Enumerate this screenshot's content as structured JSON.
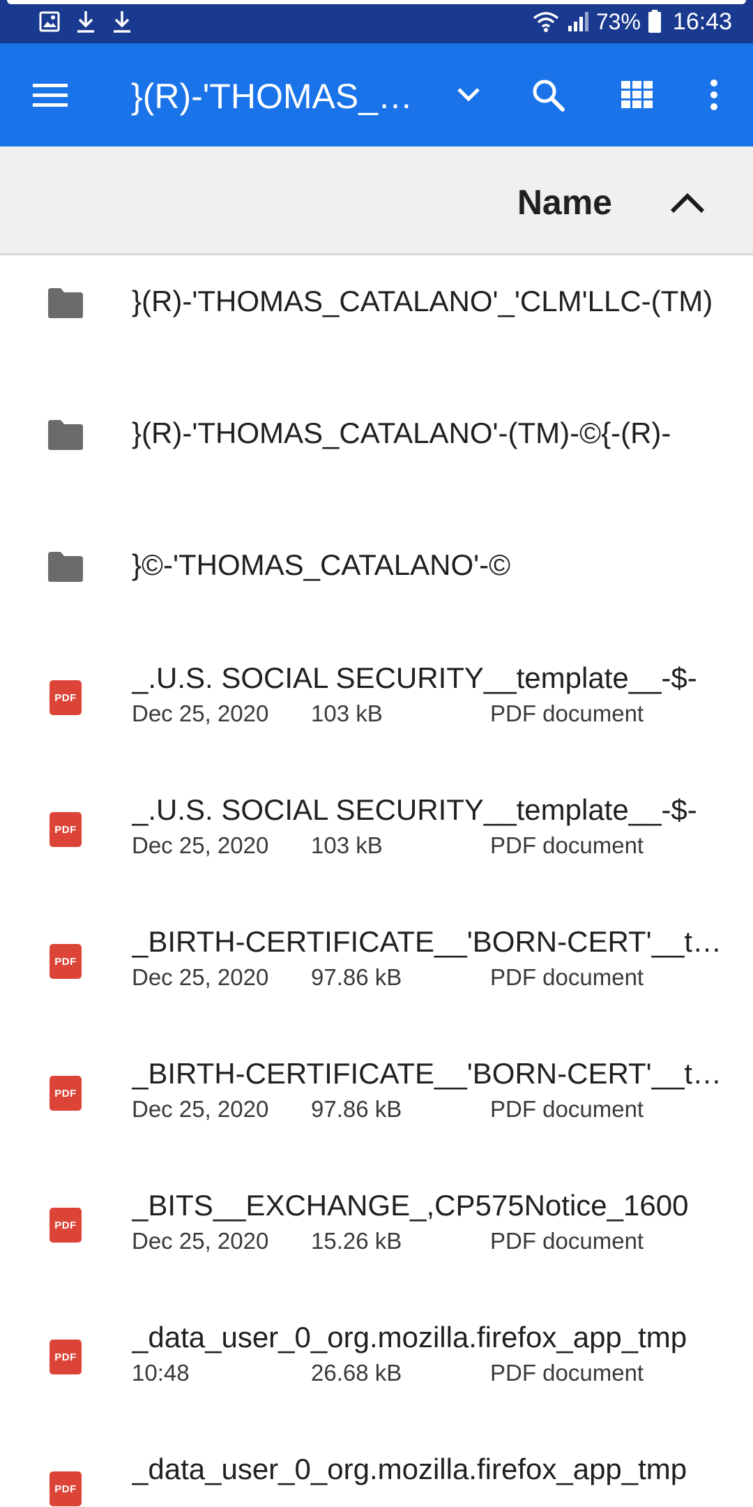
{
  "status_bar": {
    "notification_icons": [
      "gallery-icon",
      "download-icon",
      "download-icon"
    ],
    "battery_percent": "73%",
    "time": "16:43"
  },
  "app_bar": {
    "title": "}(R)-'THOMAS_CATALANO'_'CLM'LLC-(TM)",
    "background": "#1a73e8"
  },
  "sort": {
    "label": "Name",
    "direction": "ascending"
  },
  "files": [
    {
      "kind": "folder",
      "name": "}(R)-'THOMAS_CATALANO'_'CLM'LLC-(TM)"
    },
    {
      "kind": "folder",
      "name": "}(R)-'THOMAS_CATALANO'-(TM)-©{-(R)-"
    },
    {
      "kind": "folder",
      "name": "}©-'THOMAS_CATALANO'-©"
    },
    {
      "kind": "pdf",
      "name": "_.U.S. SOCIAL SECURITY__template__-$-",
      "date": "Dec 25, 2020",
      "size": "103 kB",
      "type": "PDF document"
    },
    {
      "kind": "pdf",
      "name": "_.U.S. SOCIAL SECURITY__template__-$-",
      "date": "Dec 25, 2020",
      "size": "103 kB",
      "type": "PDF document"
    },
    {
      "kind": "pdf",
      "name": "_BIRTH-CERTIFICATE__'BORN-CERT'__template",
      "date": "Dec 25, 2020",
      "size": "97.86 kB",
      "type": "PDF document"
    },
    {
      "kind": "pdf",
      "name": "_BIRTH-CERTIFICATE__'BORN-CERT'__template",
      "date": "Dec 25, 2020",
      "size": "97.86 kB",
      "type": "PDF document"
    },
    {
      "kind": "pdf",
      "name": "_BITS__EXCHANGE_,CP575Notice_1600",
      "date": "Dec 25, 2020",
      "size": "15.26 kB",
      "type": "PDF document"
    },
    {
      "kind": "pdf",
      "name": "_data_user_0_org.mozilla.firefox_app_tmp",
      "date": "10:48",
      "size": "26.68 kB",
      "type": "PDF document"
    },
    {
      "kind": "pdf",
      "name": "_data_user_0_org.mozilla.firefox_app_tmp",
      "date": "",
      "size": "",
      "type": ""
    }
  ],
  "pdf_badge_text": "PDF",
  "colors": {
    "status_bar": "#1a3a8f",
    "app_bar": "#1a73e8",
    "sort_header": "#f0f0f0",
    "folder_icon": "#6b6b6b",
    "pdf_icon": "#db4437"
  }
}
